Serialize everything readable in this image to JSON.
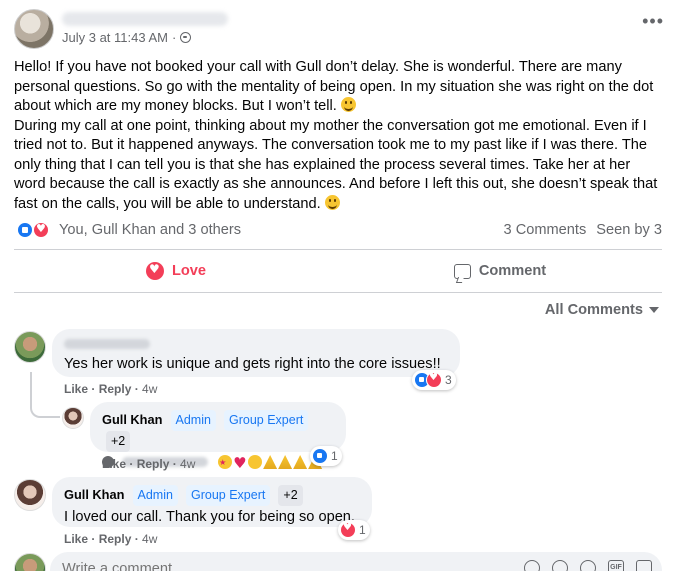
{
  "post": {
    "timestamp": "July 3 at 11:43 AM",
    "dot": "·",
    "paragraphs": [
      "Hello! If you have not booked your call with Gull don’t delay. She is wonderful. There are many personal questions. So go with the mentality of being open. In my situation she was right on the dot about which are my money blocks. But I won’t tell.",
      "During my call at one point, thinking about my mother the conversation got me emotional. Even if I tried not to. But it happened anyways. The conversation took me to my past like if I was there. The only thing that I can tell you is that she has explained the process several times. Take her at her word because the call is exactly as she announces. And before I left this out, she doesn’t speak that fast on the calls, you will be able to understand."
    ]
  },
  "reactions": {
    "names": "You, Gull Khan and 3 others",
    "comments": "3 Comments",
    "seen": "Seen by 3"
  },
  "actions": {
    "love": "Love",
    "comment": "Comment"
  },
  "comments_filter": "All Comments",
  "comments": [
    {
      "text": "Yes her work is unique and gets right into the core issues!!",
      "like": "Like",
      "reply": "Reply",
      "time": "4w",
      "reaction_count": "3"
    },
    {
      "name": "Gull Khan",
      "tags": [
        "Admin",
        "Group Expert",
        "+2"
      ],
      "like": "Like",
      "reply": "Reply",
      "time": "4w",
      "reaction_count": "1"
    },
    {
      "name": "Gull Khan",
      "tags": [
        "Admin",
        "Group Expert",
        "+2"
      ],
      "text": "I loved our call. Thank you for being so open.",
      "like": "Like",
      "reply": "Reply",
      "time": "4w",
      "reaction_count": "1"
    }
  ],
  "composer": {
    "placeholder": "Write a comment..."
  },
  "colors": {
    "accent": "#1877f2",
    "love": "#f33e58",
    "muted": "#65676b",
    "bubble": "#f0f2f5"
  },
  "icons": [
    "globe-icon",
    "more-icon",
    "like-icon",
    "love-icon",
    "comment-icon",
    "caret-icon",
    "mention-icon"
  ]
}
